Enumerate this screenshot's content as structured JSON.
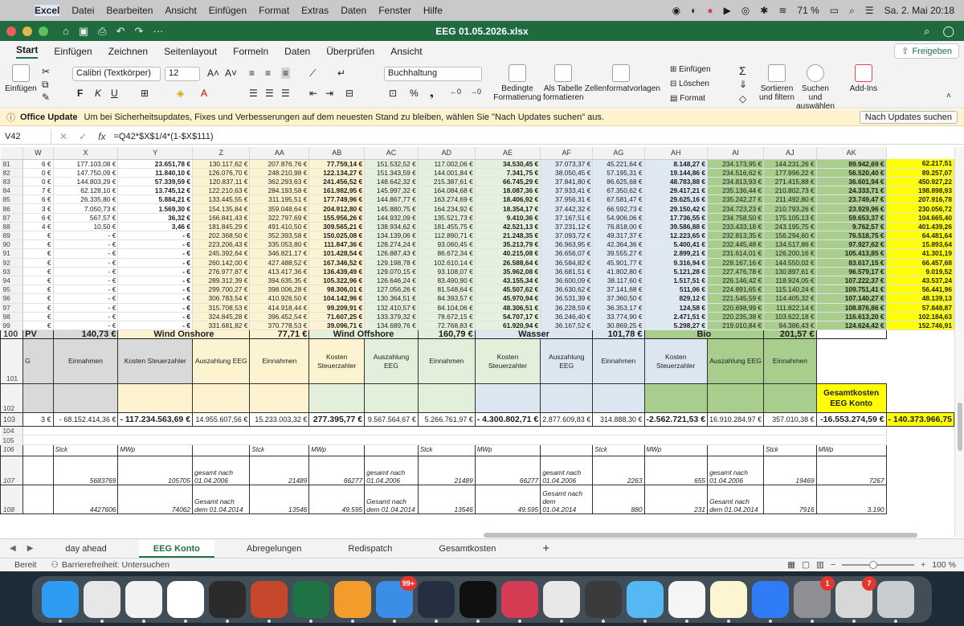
{
  "menubar": {
    "app": "Excel",
    "items": [
      "Datei",
      "Bearbeiten",
      "Ansicht",
      "Einfügen",
      "Format",
      "Extras",
      "Daten",
      "Fenster",
      "Hilfe"
    ],
    "battery": "71 %",
    "datetime": "Sa. 2. Mai  20:18"
  },
  "window": {
    "title": "EEG 01.05.2026.xlsx"
  },
  "ribbon_tabs": [
    "Start",
    "Einfügen",
    "Zeichnen",
    "Seitenlayout",
    "Formeln",
    "Daten",
    "Überprüfen",
    "Ansicht"
  ],
  "share_label": "Freigeben",
  "ribbon": {
    "paste": "Einfügen",
    "font": "Calibri (Textkörper)",
    "size": "12",
    "bold": "F",
    "italic": "K",
    "underline": "U",
    "number_format": "Buchhaltung",
    "cond_format": "Bedingte Formatierung",
    "as_table": "Als Tabelle formatieren",
    "cell_styles": "Zellenformatvorlagen",
    "insert": "Einfügen",
    "delete": "Löschen",
    "format": "Format",
    "sort": "Sortieren und filtern",
    "find": "Suchen und auswählen",
    "addins": "Add-Ins"
  },
  "update_bar": {
    "title": "Office Update",
    "message": "Um bei Sicherheitsupdates, Fixes und Verbesserungen auf dem neuesten Stand zu bleiben, wählen Sie \"Nach Updates suchen\" aus.",
    "button": "Nach Updates suchen"
  },
  "formula_bar": {
    "cell": "V42",
    "formula": "=Q42*$X$1/4*(1-$X$111)"
  },
  "columns": [
    "",
    "W",
    "X",
    "Y",
    "Z",
    "AA",
    "AB",
    "AC",
    "AD",
    "AE",
    "AF",
    "AG",
    "AH",
    "AI",
    "AJ",
    "AK"
  ],
  "data_rows": [
    [
      "81",
      "6 €",
      "177.103,08 €",
      "23.651,78 €",
      "130.117,62 €",
      "207.876,76 €",
      "77.759,14 €",
      "151.532,52 €",
      "117.002,06 €",
      "34.530,45 €",
      "37.073,37 €",
      "45.221,64 €",
      "8.148,27 €",
      "234.173,95 €",
      "144.231,26 €",
      "89.942,69 €",
      "62.217,51"
    ],
    [
      "82",
      "0 €",
      "147.750,09 €",
      "11.840,10 €",
      "126.076,70 €",
      "248.210,98 €",
      "122.134,27 €",
      "151.343,59 €",
      "144.001,84 €",
      "7.341,75 €",
      "38.050,45 €",
      "57.195,31 €",
      "19.144,86 €",
      "234.516,62 €",
      "177.996,22 €",
      "56.520,40 €",
      "89.257,07"
    ],
    [
      "83",
      "0 €",
      "144.803,29 €",
      "57.339,59 €",
      "120.837,11 €",
      "362.293,63 €",
      "241.456,52 €",
      "148.642,32 €",
      "215.387,61 €",
      "66.745,29 €",
      "37.841,80 €",
      "86.625,68 €",
      "48.783,88 €",
      "234.813,93 €",
      "271.415,88 €",
      "36.601,94 €",
      "450.927,22"
    ],
    [
      "84",
      "7 €",
      "62.128,10 €",
      "13.745,12 €",
      "122.210,63 €",
      "284.193,58 €",
      "161.982,95 €",
      "145.997,32 €",
      "164.084,68 €",
      "18.087,36 €",
      "37.933,41 €",
      "67.350,62 €",
      "29.417,21 €",
      "235.136,44 €",
      "210.802,73 €",
      "24.333,71 €",
      "198.898,93"
    ],
    [
      "85",
      "6 €",
      "26.335,80 €",
      "5.884,21 €",
      "133.445,55 €",
      "311.195,51 €",
      "177.749,96 €",
      "144.867,77 €",
      "163.274,69 €",
      "18.406,92 €",
      "37.956,31 €",
      "67.581,47 €",
      "29.625,16 €",
      "235.242,27 €",
      "211.492,80 €",
      "23.749,47 €",
      "207.916,78"
    ],
    [
      "86",
      "3 €",
      "7.050,73 €",
      "1.569,30 €",
      "154.135,84 €",
      "359.048,64 €",
      "204.912,80 €",
      "145.880,75 €",
      "164.234,92 €",
      "18.354,17 €",
      "37.442,32 €",
      "66.592,73 €",
      "29.150,42 €",
      "234.723,23 €",
      "210.793,26 €",
      "23.929,96 €",
      "230.056,72"
    ],
    [
      "87",
      "6 €",
      "567,57 €",
      "36,32 €",
      "166.841,43 €",
      "322.797,69 €",
      "155.956,26 €",
      "144.932,09 €",
      "135.521,73 €",
      "9.410,36 €",
      "37.167,51 €",
      "54.906,06 €",
      "17.736,55 €",
      "234.758,50 €",
      "175.105,13 €",
      "59.653,37 €",
      "104.665,40"
    ],
    [
      "88",
      "4 €",
      "10,50 €",
      "3,46 €",
      "181.845,29 €",
      "491.410,50 €",
      "309.565,21 €",
      "138.934,62 €",
      "181.455,75 €",
      "42.521,13 €",
      "37.231,12 €",
      "76.818,00 €",
      "39.586,88 €",
      "233.433,18 €",
      "243.195,75 €",
      "9.762,57 €",
      "401.439,26"
    ],
    [
      "89",
      "€",
      "-  €",
      "-  €",
      "202.368,50 €",
      "352.393,58 €",
      "150.025,08 €",
      "134.139,06 €",
      "112.890,71 €",
      "21.248,35 €",
      "37.093,72 €",
      "49.317,37 €",
      "12.223,65 €",
      "232.813,35 €",
      "156.294,60 €",
      "76.518,75 €",
      "64.481,64"
    ],
    [
      "90",
      "€",
      "-  €",
      "-  €",
      "223.206,43 €",
      "335.053,80 €",
      "111.847,36 €",
      "128.274,24 €",
      "93.060,45 €",
      "35.213,79 €",
      "36.963,95 €",
      "42.364,36 €",
      "5.400,41 €",
      "232.445,48 €",
      "134.517,86 €",
      "97.927,62 €",
      "15.893,64"
    ],
    [
      "91",
      "€",
      "-  €",
      "-  €",
      "245.392,64 €",
      "346.821,17 €",
      "101.428,54 €",
      "126.887,43 €",
      "86.672,34 €",
      "40.215,08 €",
      "36.656,07 €",
      "39.555,27 €",
      "2.899,21 €",
      "231.614,01 €",
      "126.200,16 €",
      "105.413,85 €",
      "41.301,19"
    ],
    [
      "92",
      "€",
      "-  €",
      "-  €",
      "260.142,00 €",
      "427.488,52 €",
      "167.346,52 €",
      "129.198,78 €",
      "102.610,14 €",
      "26.588,64 €",
      "36.584,82 €",
      "45.901,77 €",
      "9.316,94 €",
      "228.167,16 €",
      "144.550,02 €",
      "83.617,15 €",
      "66.457,68"
    ],
    [
      "93",
      "€",
      "-  €",
      "-  €",
      "276.977,87 €",
      "413.417,36 €",
      "136.439,49 €",
      "129.070,15 €",
      "93.108,07 €",
      "35.962,08 €",
      "36.681,51 €",
      "41.802,80 €",
      "5.121,28 €",
      "227.476,78 €",
      "130.897,61 €",
      "96.579,17 €",
      "9.019,52"
    ],
    [
      "94",
      "€",
      "-  €",
      "-  €",
      "289.312,39 €",
      "394.635,35 €",
      "105.322,96 €",
      "126.646,24 €",
      "83.490,90 €",
      "43.155,34 €",
      "36.600,09 €",
      "38.117,60 €",
      "1.517,51 €",
      "226.146,42 €",
      "118.924,05 €",
      "107.222,37 €",
      "43.537,24"
    ],
    [
      "95",
      "€",
      "-  €",
      "-  €",
      "299.700,27 €",
      "398.006,28 €",
      "98.306,01 €",
      "127.056,26 €",
      "81.548,64 €",
      "45.507,62 €",
      "36.630,62 €",
      "37.141,68 €",
      "511,06 €",
      "224.891,65 €",
      "115.140,24 €",
      "109.751,41 €",
      "56.441,96"
    ],
    [
      "96",
      "€",
      "-  €",
      "-  €",
      "306.783,54 €",
      "410.926,50 €",
      "104.142,96 €",
      "130.364,51 €",
      "84.393,57 €",
      "45.970,94 €",
      "36.531,39 €",
      "37.360,50 €",
      "829,12 €",
      "221.545,59 €",
      "114.405,32 €",
      "107.140,27 €",
      "48.139,13"
    ],
    [
      "97",
      "€",
      "-  €",
      "-  €",
      "315.708,53 €",
      "414.918,44 €",
      "99.209,91 €",
      "132.410,57 €",
      "84.104,06 €",
      "48.306,51 €",
      "36.228,59 €",
      "36.353,17 €",
      "124,58 €",
      "220.698,99 €",
      "111.822,14 €",
      "108.876,86 €",
      "57.848,87"
    ],
    [
      "98",
      "€",
      "-  €",
      "-  €",
      "324.845,28 €",
      "396.452,54 €",
      "71.607,25 €",
      "133.379,32 €",
      "78.672,15 €",
      "54.707,17 €",
      "36.246,40 €",
      "33.774,90 €",
      "2.471,51 €",
      "220.235,38 €",
      "103.622,18 €",
      "116.613,20 €",
      "102.184,63"
    ],
    [
      "99",
      "€",
      "-  €",
      "-  €",
      "331.681,82 €",
      "370.778,53 €",
      "39.096,71 €",
      "134.689,76 €",
      "72.768,83 €",
      "61.920,94 €",
      "36.167,52 €",
      "30.869,25 €",
      "5.298,27 €",
      "219.010,84 €",
      "94.386,43 €",
      "124.624,42 €",
      "152.746,91"
    ]
  ],
  "section_row": {
    "num": "100",
    "pv": "PV",
    "pv_total": "140,73 €",
    "wind_on": "Wind Onshore",
    "wind_on_total": "77,71 €",
    "wind_off": "Wind Offshore",
    "wind_off_total": "160,79 €",
    "wasser": "Wasser",
    "wasser_total": "101,78 €",
    "bio": "Bio",
    "bio_total": "201,57 €"
  },
  "label_row": {
    "num": "101",
    "w": "G",
    "x1": "Einnahmen",
    "x2": "Kosten Steuerzahler",
    "y": "Auszahlung EEG",
    "z": "Einnahmen",
    "aa": "Kosten Steuerzahler",
    "ab": "Auszahlung EEG",
    "ac": "Einnahmen",
    "ad": "Kosten Steuerzahler",
    "ae": "Auszahlung EEG",
    "af": "Einnahmen",
    "ag": "Kosten Steuerzahler",
    "ah": "Auszahlung EEG",
    "ai": "Einnahmen",
    "aj": "Kosten Steuerzahler"
  },
  "row102": {
    "num": "102",
    "gesamt": "Gesamtkosten EEG Konto"
  },
  "total_row": {
    "num": "103",
    "w": "3 €",
    "x1": "- 68.152.414,36 €",
    "x2": "- 117.234.563,69 €",
    "y": "14.955.607,56 €",
    "z": "15.233.003,32 €",
    "aa": "277.395,77 €",
    "ab": "9.567.564,67 €",
    "ac": "5.266.761,97 €",
    "ad": "- 4.300.802,71 €",
    "ae": "2.877.609,83 €",
    "af": "314.888,30 €",
    "ag": "-2.562.721,53 €",
    "ah": "16.910.284,97 €",
    "ai": "357.010,38 €",
    "aj": "-16.553.274,59 €",
    "ak": "- 140.373.966,75"
  },
  "empty_rows": [
    "104",
    "105"
  ],
  "unit_row": {
    "num": "106",
    "stck": "Stck",
    "mwp": "MWp"
  },
  "row107": {
    "num": "107",
    "x1": "5683769",
    "x2": "105705",
    "y": "gesamt nach 01.04.2006",
    "z": "21489",
    "aa": "66277",
    "ab": "gesamt nach 01.04.2006",
    "ac": "21489",
    "ad": "66277",
    "ae": "gesamt nach 01.04.2006",
    "af": "2263",
    "ag": "655",
    "ah": "gesamt nach 01.04.2006",
    "ai": "19469",
    "aj": "7267"
  },
  "row108": {
    "num": "108",
    "x1": "4427606",
    "x2": "74062",
    "y": "Gesamt nach dem 01.04.2014",
    "z": "13546",
    "aa": "49.595",
    "ab": "Gesamt nach dem 01.04.2014",
    "ac": "13546",
    "ad": "49.595",
    "ae": "Gesamt nach dem 01.04.2014",
    "af": "880",
    "ag": "231",
    "ah": "Gesamt nach dem 01.04.2014",
    "ai": "7916",
    "aj": "3.190"
  },
  "sheet_tabs": [
    "day ahead",
    "EEG Konto",
    "Abregelungen",
    "Redispatch",
    "Gesamtkosten"
  ],
  "active_sheet": "EEG Konto",
  "status": {
    "ready": "Bereit",
    "accessibility": "Barrierefreiheit: Untersuchen",
    "zoom": "100 %"
  },
  "dock": [
    {
      "name": "finder-icon",
      "color": "#2f9bf0"
    },
    {
      "name": "launchpad-icon",
      "color": "#e7e7ea"
    },
    {
      "name": "chrome-icon",
      "color": "#f2f2f2"
    },
    {
      "name": "vpn-icon",
      "color": "#ffffff"
    },
    {
      "name": "obs-icon",
      "color": "#2b2b2b"
    },
    {
      "name": "powerpoint-icon",
      "color": "#c6472c"
    },
    {
      "name": "excel-icon",
      "color": "#1f7244"
    },
    {
      "name": "uberall-icon",
      "color": "#f39c2b"
    },
    {
      "name": "mail-icon",
      "color": "#3a8ee6",
      "badge": "99+"
    },
    {
      "name": "davinci-icon",
      "color": "#243040"
    },
    {
      "name": "activity-icon",
      "color": "#101010"
    },
    {
      "name": "cloud-icon",
      "color": "#d63b54"
    },
    {
      "name": "venture-icon",
      "color": "#e8e8e8"
    },
    {
      "name": "calculator-icon",
      "color": "#3b3b3b"
    },
    {
      "name": "maps-icon",
      "color": "#55b8f3"
    },
    {
      "name": "photos-icon",
      "color": "#f5f5f5"
    },
    {
      "name": "notes-icon",
      "color": "#fbf5d2"
    },
    {
      "name": "appstore-icon",
      "color": "#2f7cf6"
    },
    {
      "name": "settings-icon",
      "color": "#8f8f94",
      "badge": "1"
    },
    {
      "name": "gift-icon",
      "color": "#d7d7d7",
      "badge": "7"
    },
    {
      "name": "trash-icon",
      "color": "#c8cdd2"
    }
  ]
}
